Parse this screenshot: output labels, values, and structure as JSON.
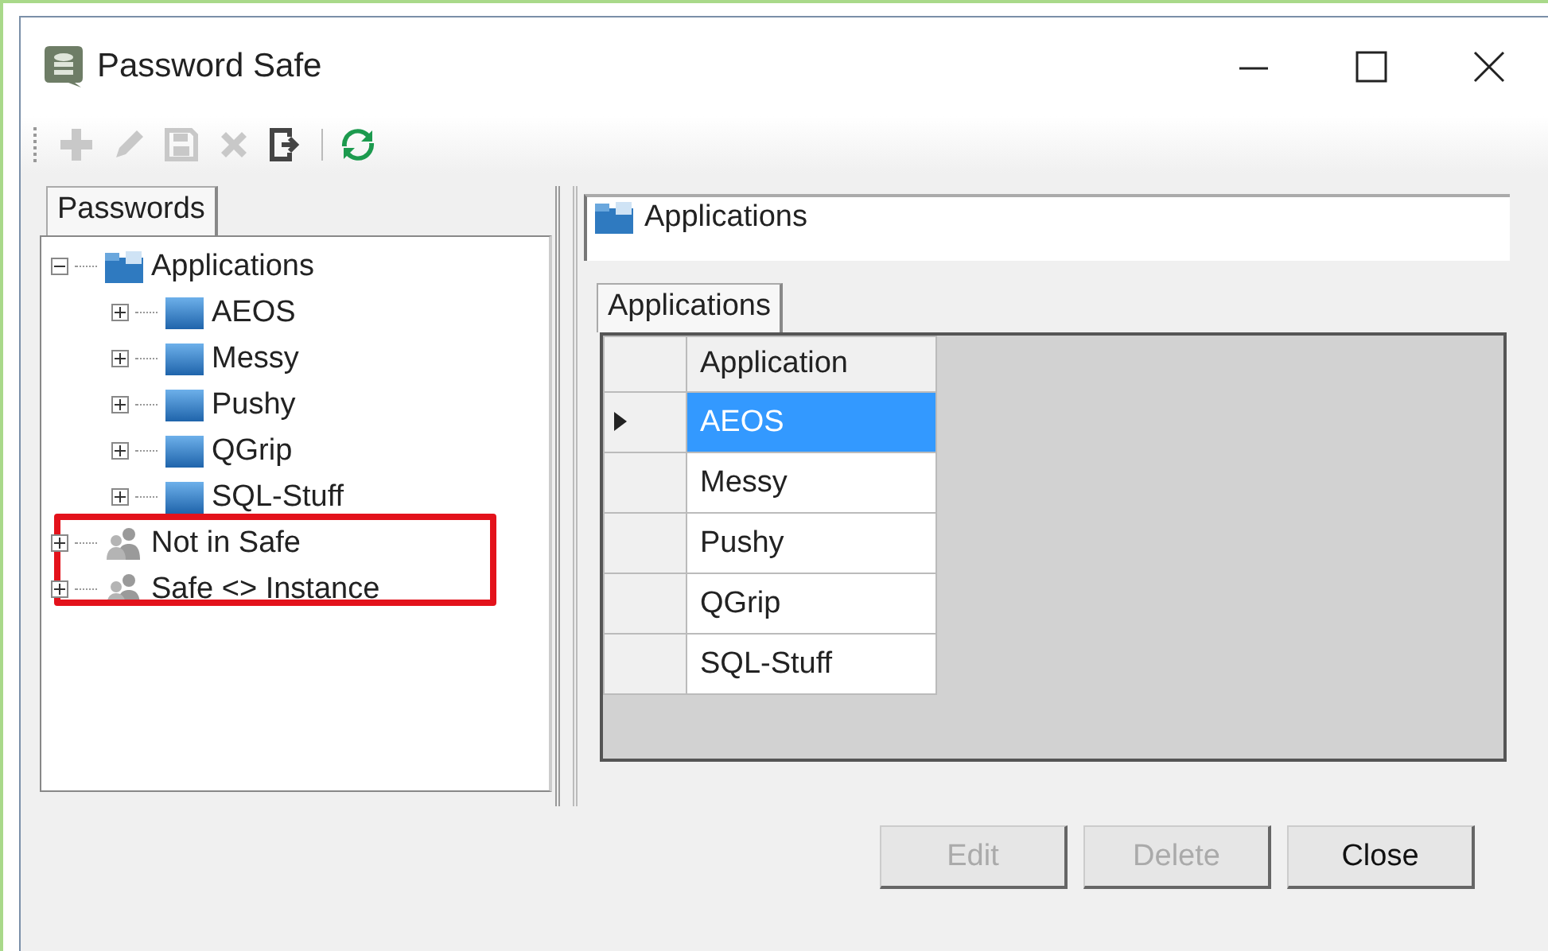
{
  "window": {
    "title": "Password Safe"
  },
  "toolbar": [
    {
      "kind": "add",
      "disabled": true
    },
    {
      "kind": "edit",
      "disabled": true
    },
    {
      "kind": "save",
      "disabled": true
    },
    {
      "kind": "delete",
      "disabled": true
    },
    {
      "kind": "exit",
      "disabled": false
    },
    {
      "kind": "refresh",
      "disabled": false
    }
  ],
  "left_tabs": [
    {
      "label": "Passwords",
      "selected": true
    }
  ],
  "tree": [
    {
      "label": "Applications",
      "kind": "group",
      "expanded": true,
      "children": [
        {
          "label": "AEOS",
          "kind": "item",
          "expanded": false
        },
        {
          "label": "Messy",
          "kind": "item",
          "expanded": false
        },
        {
          "label": "Pushy",
          "kind": "item",
          "expanded": false
        },
        {
          "label": "QGrip",
          "kind": "item",
          "expanded": false
        },
        {
          "label": "SQL-Stuff",
          "kind": "item",
          "expanded": false
        }
      ]
    },
    {
      "label": "Not in Safe",
      "kind": "people",
      "expanded": false
    },
    {
      "label": "Safe <> Instance",
      "kind": "people",
      "expanded": false
    }
  ],
  "header": {
    "title": "Applications"
  },
  "right_tabs": [
    {
      "label": "Applications",
      "selected": true
    }
  ],
  "table": {
    "columns": [
      "Application"
    ],
    "rows": [
      {
        "cells": [
          "AEOS"
        ],
        "selected": true
      },
      {
        "cells": [
          "Messy"
        ],
        "selected": false
      },
      {
        "cells": [
          "Pushy"
        ],
        "selected": false
      },
      {
        "cells": [
          "QGrip"
        ],
        "selected": false
      },
      {
        "cells": [
          "SQL-Stuff"
        ],
        "selected": false
      }
    ]
  },
  "buttons": [
    {
      "label": "Edit",
      "disabled": true
    },
    {
      "label": "Delete",
      "disabled": true
    },
    {
      "label": "Close",
      "disabled": false
    }
  ]
}
